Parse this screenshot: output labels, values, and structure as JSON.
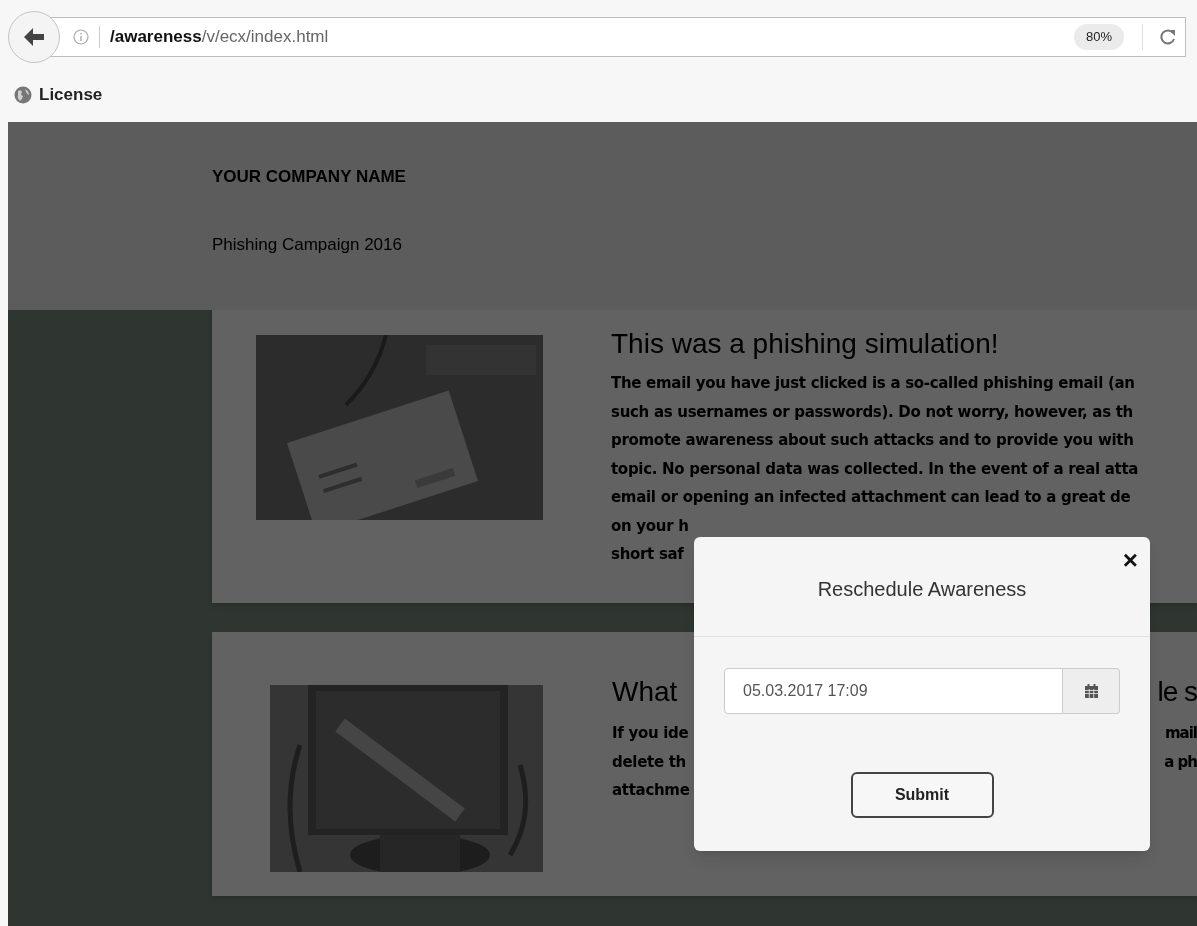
{
  "browser": {
    "url_bold": "/awareness",
    "url_rest": "/v/ecx/index.html",
    "zoom": "80%",
    "bookmarks": [
      "License"
    ]
  },
  "header": {
    "company": "YOUR COMPANY NAME",
    "campaign": "Phishing Campaign 2016"
  },
  "cards": [
    {
      "heading": {
        "left": "This was a phishing simulation!"
      },
      "lines": [
        {
          "left": "The email you have just clicked is a so-called phishing email (an"
        },
        {
          "left": "such as usernames or passwords). Do not worry, however, as th"
        },
        {
          "left": "promote awareness about such attacks and to provide you with"
        },
        {
          "left": "topic. No personal data was collected. In the event of a real atta"
        },
        {
          "left": "email or opening an infected attachment can lead to a great de"
        },
        {
          "left": "on your h"
        },
        {
          "left": "short saf"
        }
      ]
    },
    {
      "heading": {
        "left": "What",
        "right": "le s"
      },
      "lines": [
        {
          "left": "If you ide",
          "right": "mail"
        },
        {
          "left": "delete th",
          "right": "a ph"
        },
        {
          "left": "attachme"
        }
      ]
    }
  ],
  "modal": {
    "title": "Reschedule Awareness",
    "close": "×",
    "date_value": "05.03.2017 17:09",
    "submit": "Submit"
  }
}
